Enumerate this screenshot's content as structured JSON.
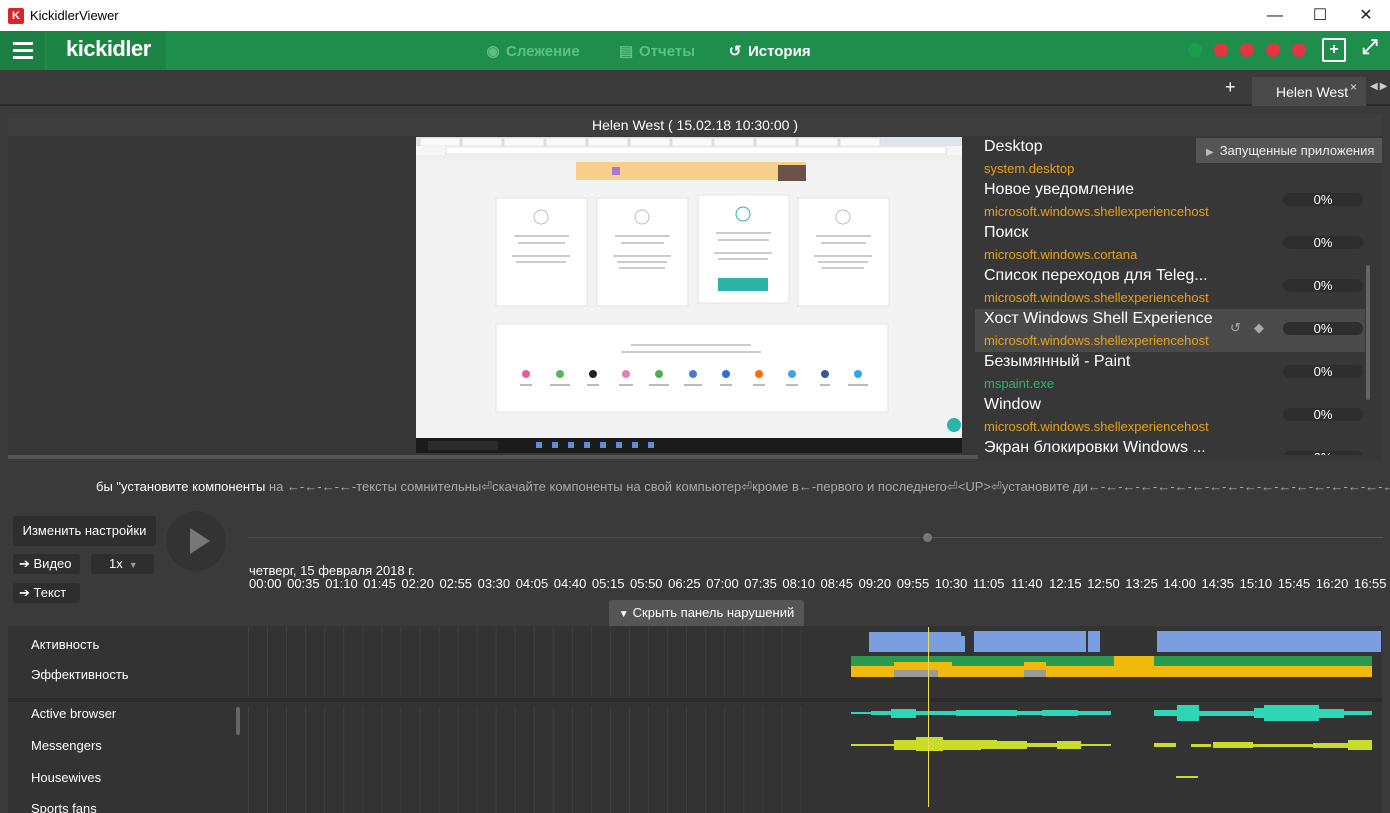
{
  "window": {
    "title": "KickidlerViewer",
    "app_icon": "K",
    "controls": [
      "—",
      "☐",
      "✕"
    ]
  },
  "header": {
    "logo": "kickidler",
    "tabs": [
      {
        "label": "Слежение",
        "icon": "eye-icon",
        "active": false
      },
      {
        "label": "Отчеты",
        "icon": "document-icon",
        "active": false
      },
      {
        "label": "История",
        "icon": "history-icon",
        "active": true
      }
    ],
    "status_dots": [
      "#1a9e4b",
      "#e0363f",
      "#e0363f",
      "#e0363f",
      "#e0363f"
    ]
  },
  "tabs": {
    "add": "+",
    "user_tab": "Helen West",
    "close": "×",
    "arrows": "◀▶"
  },
  "viewer": {
    "title": "Helen West   ( 15.02.18 10:30:00 )",
    "apps_button": "Запущенные приложения",
    "apps": [
      {
        "name": "Desktop",
        "process": "system.desktop",
        "percent": "",
        "proc_color": "#e8a21a"
      },
      {
        "name": "Новое уведомление",
        "process": "microsoft.windows.shellexperiencehost",
        "percent": "0%",
        "proc_color": "#e8a21a"
      },
      {
        "name": "Поиск",
        "process": "microsoft.windows.cortana",
        "percent": "0%",
        "proc_color": "#e8a21a"
      },
      {
        "name": "Список переходов для Teleg...",
        "process": "microsoft.windows.shellexperiencehost",
        "percent": "0%",
        "proc_color": "#e8a21a"
      },
      {
        "name": "Хост Windows Shell Experience",
        "process": "microsoft.windows.shellexperiencehost",
        "percent": "0%",
        "proc_color": "#e8a21a"
      },
      {
        "name": "Безымянный - Paint",
        "process": "mspaint.exe",
        "percent": "0%",
        "proc_color": "#2fb36b"
      },
      {
        "name": "Window",
        "process": "microsoft.windows.shellexperiencehost",
        "percent": "0%",
        "proc_color": "#e8a21a"
      },
      {
        "name": "Экран блокировки Windows ...",
        "process": "",
        "percent": "0%",
        "proc_color": "#e8a21a"
      }
    ]
  },
  "keylog": {
    "highlight": "бы \"установите компоненты",
    "rest": " на ←-←-←-←-тексты сомнительны⏎скачайте компоненты на свой компьютер⏎кроме в←-первого и последнего⏎<UP>⏎установите ди←-←-←-←-←-←-←-←-←-←-←-←-←-←-←-←-←-←-←-←-←-←-←"
  },
  "controls": {
    "settings": "Изменить настройки",
    "video": "Видео",
    "speed": "1x",
    "text": "Текст",
    "hide_panel": "Скрыть панель нарушений"
  },
  "timeline": {
    "date": "четверг, 15 февраля 2018 г.",
    "ticks": [
      "00:00",
      "00:35",
      "01:10",
      "01:45",
      "02:20",
      "02:55",
      "03:30",
      "04:05",
      "04:40",
      "05:15",
      "05:50",
      "06:25",
      "07:00",
      "07:35",
      "08:10",
      "08:45",
      "09:20",
      "09:55",
      "10:30",
      "11:05",
      "11:40",
      "12:15",
      "12:50",
      "13:25",
      "14:00",
      "14:35",
      "15:10",
      "15:45",
      "16:20",
      "16:55"
    ],
    "progress": 0.6
  },
  "violations": {
    "rows": [
      "Активность",
      "Эффективность",
      "Active browser",
      "Messengers",
      "Housewives",
      "Sports fans"
    ],
    "colors": {
      "activity": "#7b9ee0",
      "efficient": "#2a9a4e",
      "neutral": "#f0b90b",
      "idle": "#9a9a9a",
      "browser": "#2fd6b6",
      "messengers": "#c8dc2a"
    }
  }
}
